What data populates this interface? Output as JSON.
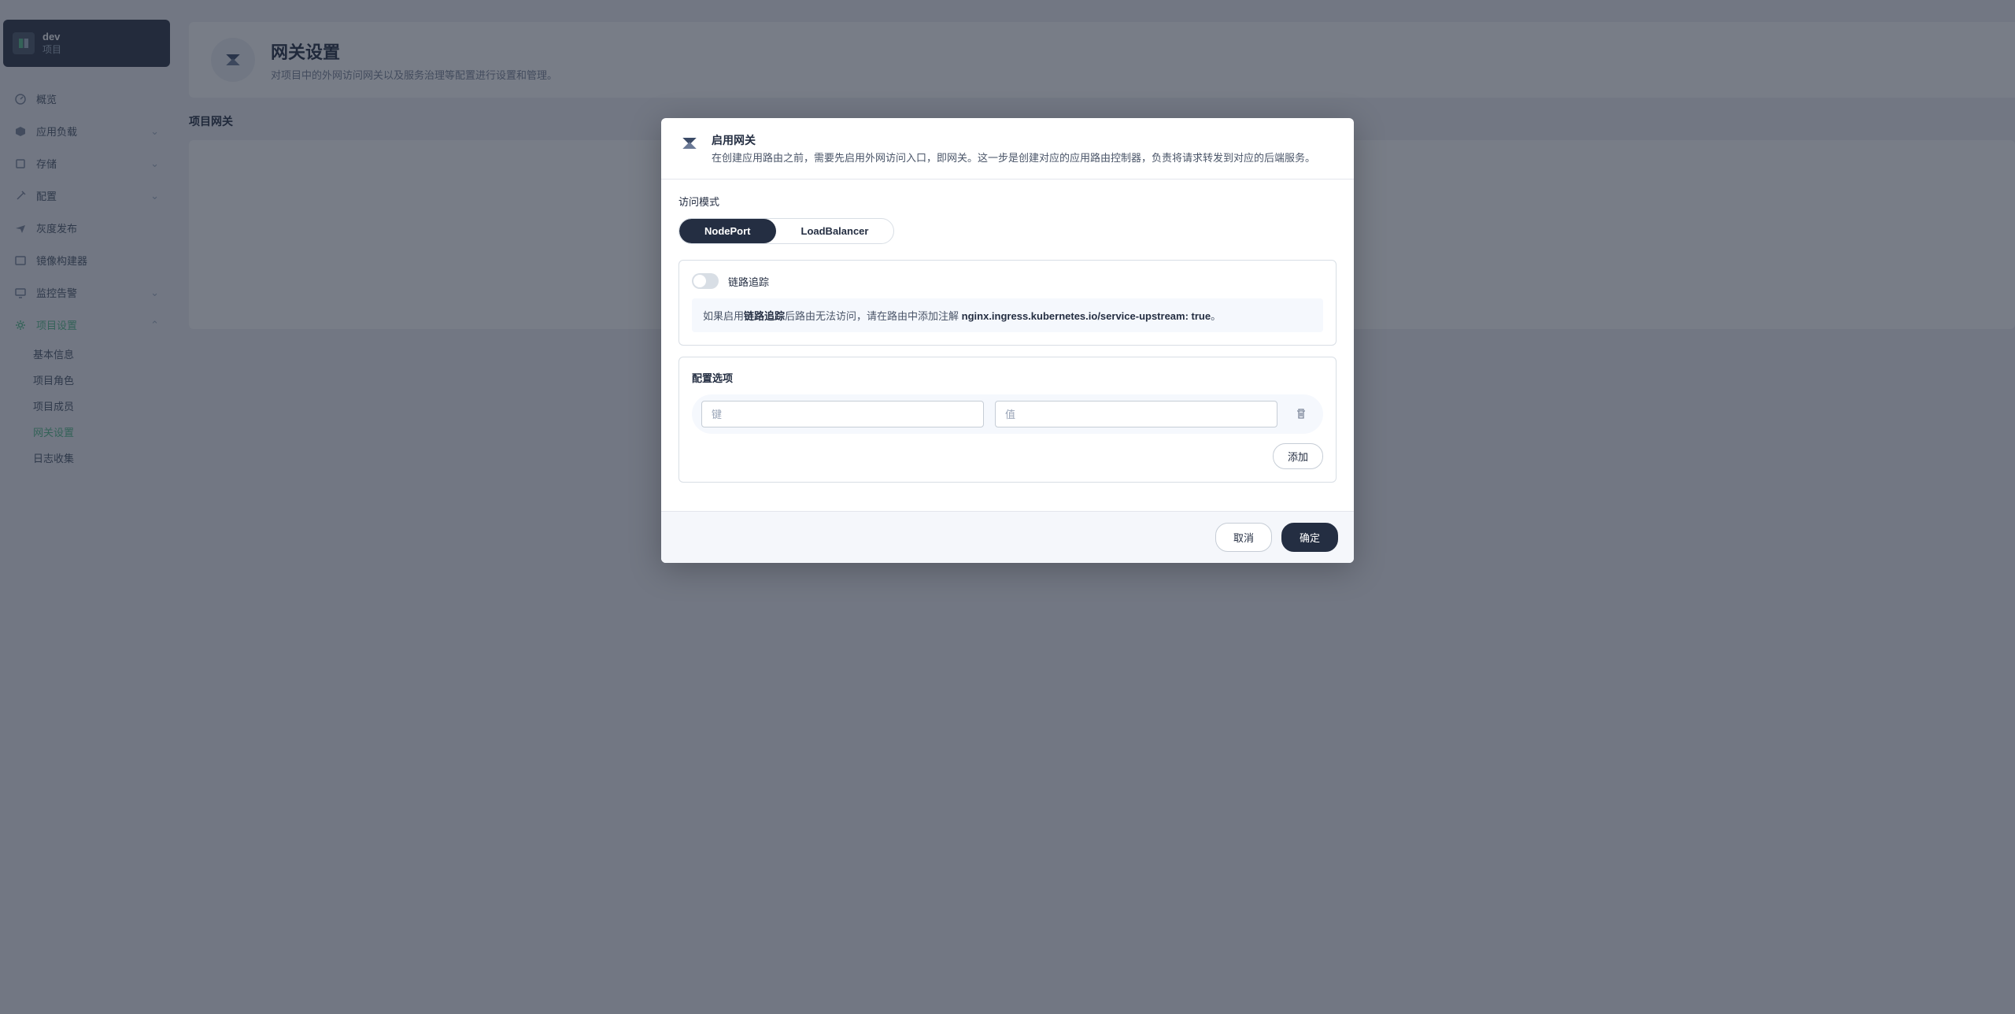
{
  "project": {
    "name": "dev",
    "type": "项目"
  },
  "nav": {
    "overview": "概览",
    "workloads": "应用负载",
    "storage": "存储",
    "configuration": "配置",
    "grayrelease": "灰度发布",
    "imagebuilder": "镜像构建器",
    "monitoring": "监控告警",
    "projectsettings": "项目设置",
    "sub_basic": "基本信息",
    "sub_roles": "项目角色",
    "sub_members": "项目成员",
    "sub_gateway": "网关设置",
    "sub_logcollect": "日志收集"
  },
  "page": {
    "title": "网关设置",
    "subtitle": "对项目中的外网访问网关以及服务治理等配置进行设置和管理。",
    "section": "项目网关"
  },
  "modal": {
    "title": "启用网关",
    "desc": "在创建应用路由之前，需要先启用外网访问入口，即网关。这一步是创建对应的应用路由控制器，负责将请求转发到对应的后端服务。",
    "access_mode_label": "访问模式",
    "tab_nodeport": "NodePort",
    "tab_loadbalancer": "LoadBalancer",
    "trace_label": "链路追踪",
    "hint_prefix": "如果启用",
    "hint_bold": "链路追踪",
    "hint_mid": "后路由无法访问，请在路由中添加注解 ",
    "hint_code": "nginx.ingress.kubernetes.io/service-upstream: true",
    "hint_suffix": "。",
    "config_title": "配置选项",
    "key_placeholder": "键",
    "value_placeholder": "值",
    "add_btn": "添加",
    "cancel": "取消",
    "confirm": "确定"
  }
}
